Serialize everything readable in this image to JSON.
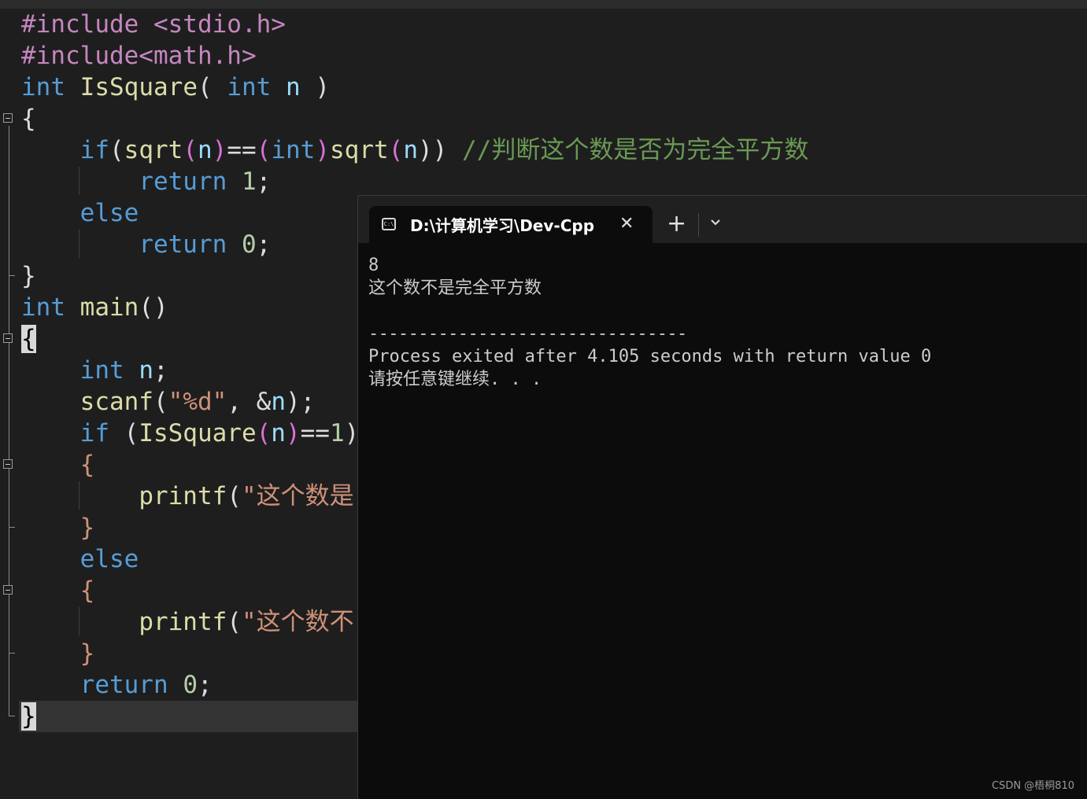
{
  "editor": {
    "lines": [
      {
        "tokens": [
          [
            "#include <stdio.h>",
            "pp"
          ]
        ]
      },
      {
        "tokens": [
          [
            "#include<math.h>",
            "pp"
          ]
        ]
      },
      {
        "tokens": [
          [
            "int",
            "kw"
          ],
          [
            " ",
            "pl"
          ],
          [
            "IsSquare",
            "fn"
          ],
          [
            "( ",
            "pl"
          ],
          [
            "int",
            "kw"
          ],
          [
            " ",
            "pl"
          ],
          [
            "n",
            "id"
          ],
          [
            " )",
            "pl"
          ]
        ]
      },
      {
        "tokens": [
          [
            "{",
            "pl"
          ]
        ]
      },
      {
        "tokens": [
          [
            "    ",
            "pl"
          ],
          [
            "if",
            "kw"
          ],
          [
            "(",
            "pl"
          ],
          [
            "sqrt",
            "fn"
          ],
          [
            "(",
            "par"
          ],
          [
            "n",
            "id"
          ],
          [
            ")",
            "par"
          ],
          [
            "==",
            "pl"
          ],
          [
            "(",
            "par"
          ],
          [
            "int",
            "kw"
          ],
          [
            ")",
            "par"
          ],
          [
            "sqrt",
            "fn"
          ],
          [
            "(",
            "par"
          ],
          [
            "n",
            "id"
          ],
          [
            "))",
            "pl"
          ],
          [
            " ",
            "pl"
          ],
          [
            "//判断这个数是否为完全平方数",
            "cmt"
          ]
        ]
      },
      {
        "tokens": [
          [
            "        ",
            "pl"
          ],
          [
            "return",
            "kw"
          ],
          [
            " ",
            "pl"
          ],
          [
            "1",
            "num"
          ],
          [
            ";",
            "pl"
          ]
        ]
      },
      {
        "tokens": [
          [
            "    ",
            "pl"
          ],
          [
            "else",
            "kw"
          ]
        ]
      },
      {
        "tokens": [
          [
            "        ",
            "pl"
          ],
          [
            "return",
            "kw"
          ],
          [
            " ",
            "pl"
          ],
          [
            "0",
            "num"
          ],
          [
            ";",
            "pl"
          ]
        ]
      },
      {
        "tokens": [
          [
            "}",
            "pl"
          ]
        ]
      },
      {
        "tokens": [
          [
            "int",
            "kw"
          ],
          [
            " ",
            "pl"
          ],
          [
            "main",
            "fn"
          ],
          [
            "()",
            "pl"
          ]
        ]
      },
      {
        "tokens": [
          [
            "{",
            "brace-hl"
          ]
        ]
      },
      {
        "tokens": [
          [
            "    ",
            "pl"
          ],
          [
            "int",
            "kw"
          ],
          [
            " ",
            "pl"
          ],
          [
            "n",
            "id"
          ],
          [
            ";",
            "pl"
          ]
        ]
      },
      {
        "tokens": [
          [
            "    ",
            "pl"
          ],
          [
            "scanf",
            "fn"
          ],
          [
            "(",
            "pl"
          ],
          [
            "\"%d\"",
            "str"
          ],
          [
            ", &",
            "pl"
          ],
          [
            "n",
            "id"
          ],
          [
            ");",
            "pl"
          ]
        ]
      },
      {
        "tokens": [
          [
            "    ",
            "pl"
          ],
          [
            "if",
            "kw"
          ],
          [
            " (",
            "pl"
          ],
          [
            "IsSquare",
            "fn"
          ],
          [
            "(",
            "par"
          ],
          [
            "n",
            "id"
          ],
          [
            ")",
            "par"
          ],
          [
            "==",
            "pl"
          ],
          [
            "1",
            "num"
          ],
          [
            ")",
            "pl"
          ]
        ]
      },
      {
        "tokens": [
          [
            "    ",
            "pl"
          ],
          [
            "{",
            "str"
          ]
        ]
      },
      {
        "tokens": [
          [
            "        ",
            "pl"
          ],
          [
            "printf",
            "fn"
          ],
          [
            "(",
            "pl"
          ],
          [
            "\"这个数是",
            "str"
          ]
        ]
      },
      {
        "tokens": [
          [
            "    ",
            "pl"
          ],
          [
            "}",
            "str"
          ]
        ]
      },
      {
        "tokens": [
          [
            "    ",
            "pl"
          ],
          [
            "else",
            "kw"
          ]
        ]
      },
      {
        "tokens": [
          [
            "    ",
            "pl"
          ],
          [
            "{",
            "str"
          ]
        ]
      },
      {
        "tokens": [
          [
            "        ",
            "pl"
          ],
          [
            "printf",
            "fn"
          ],
          [
            "(",
            "pl"
          ],
          [
            "\"这个数不",
            "str"
          ]
        ]
      },
      {
        "tokens": [
          [
            "    ",
            "pl"
          ],
          [
            "}",
            "str"
          ]
        ]
      },
      {
        "tokens": [
          [
            "    ",
            "pl"
          ],
          [
            "return",
            "kw"
          ],
          [
            " ",
            "pl"
          ],
          [
            "0",
            "num"
          ],
          [
            ";",
            "pl"
          ]
        ]
      },
      {
        "tokens": [
          [
            "}",
            "brace-hl"
          ]
        ]
      }
    ]
  },
  "terminal": {
    "tab_title": "D:\\计算机学习\\Dev-Cpp",
    "tab_icon": "terminal-icon",
    "close_symbol": "✕",
    "new_tab_symbol": "+",
    "dropdown_icon": "chevron-down-icon",
    "output": {
      "input_echo": "8",
      "result": "这个数不是完全平方数",
      "separator": "--------------------------------",
      "exit_message": "Process exited after 4.105 seconds with return value 0",
      "pause_prompt": "请按任意键继续. . ."
    }
  },
  "watermark": "CSDN @梧桐810"
}
